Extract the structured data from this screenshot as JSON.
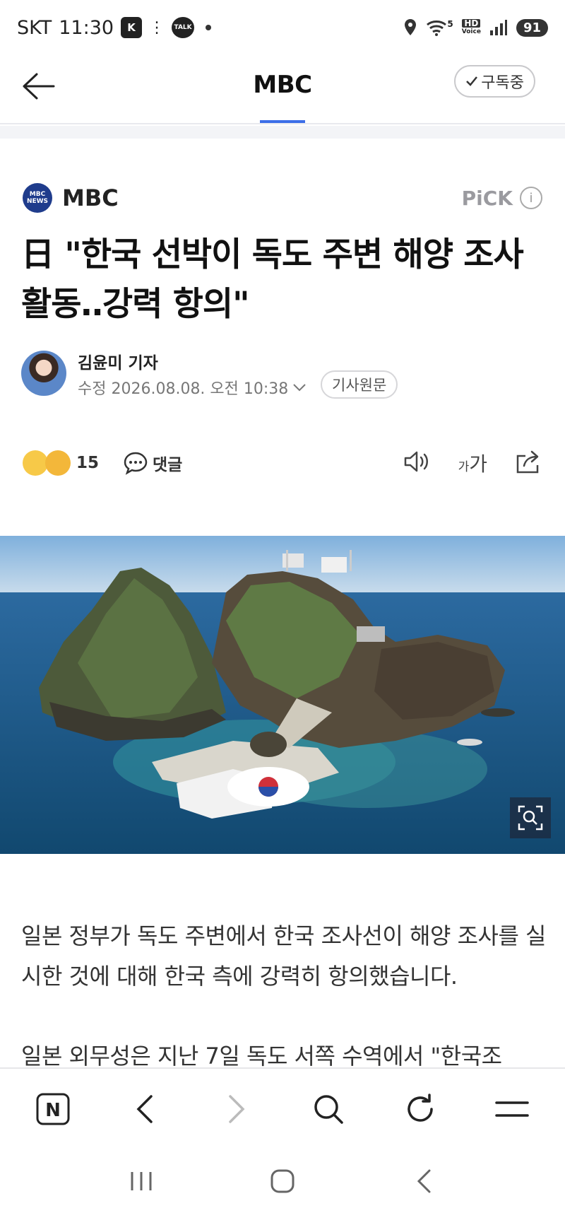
{
  "status_bar": {
    "carrier": "SKT",
    "time": "11:30",
    "talk_label": "TALK",
    "hd_label": "HD",
    "voice_label": "Voice",
    "network": "5",
    "battery": "91"
  },
  "nav": {
    "title": "MBC",
    "subscribe_label": "구독중"
  },
  "article": {
    "press_name": "MBC",
    "press_logo_top": "MBC",
    "press_logo_bottom": "NEWS",
    "pick_label": "PiCK",
    "headline": "日 \"한국 선박이 독도 주변 해양 조사 활동‥강력 항의\"",
    "author": "김윤미 기자",
    "date_line": "수정 2026.08.08. 오전 10:38",
    "original_label": "기사원문",
    "reaction_count": "15",
    "comment_label": "댓글",
    "font_small": "가",
    "font_large": "가",
    "paragraphs": [
      "일본 정부가 독도 주변에서 한국 조사선이 해양 조사를 실시한 것에 대해 한국 측에 강력히 항의했습니다.",
      "일본 외무성은 지난 7일 독도 서쪽 수역에서 \"한국조"
    ]
  },
  "bottom_bar": {
    "home_label": "N"
  }
}
